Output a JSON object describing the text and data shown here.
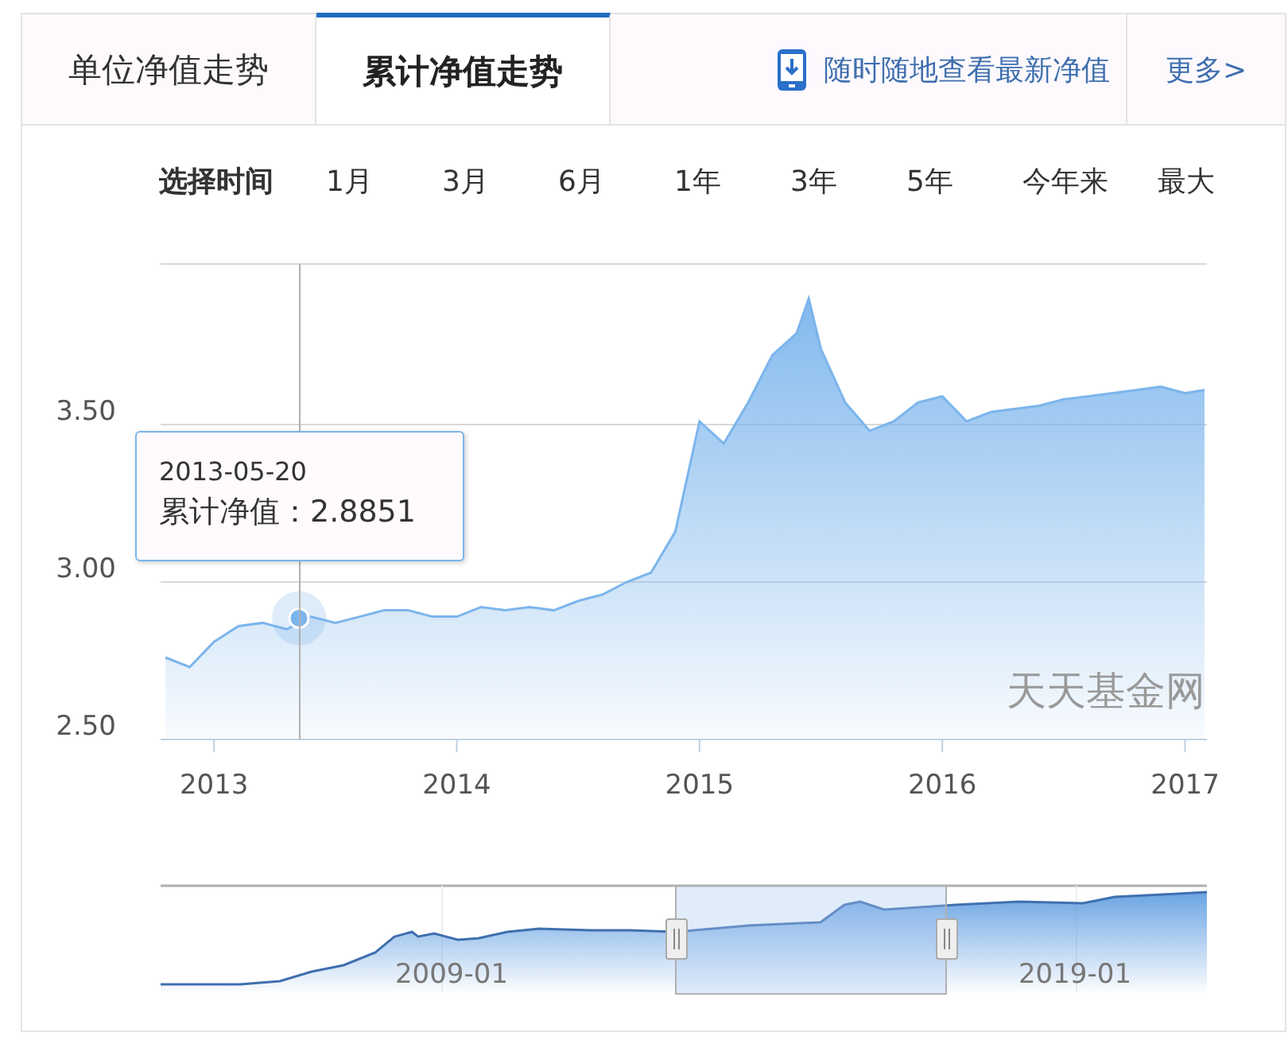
{
  "tabs": [
    {
      "label": "单位净值走势",
      "selected": false
    },
    {
      "label": "累计净值走势",
      "selected": true
    }
  ],
  "app_link": "随时随地查看最新净值",
  "more_link": "更多>",
  "range_label": "选择时间",
  "ranges": [
    {
      "label": "1月",
      "selected": false
    },
    {
      "label": "3月",
      "selected": false
    },
    {
      "label": "6月",
      "selected": false
    },
    {
      "label": "1年",
      "selected": false
    },
    {
      "label": "3年",
      "selected": false
    },
    {
      "label": "5年",
      "selected": false
    },
    {
      "label": "今年来",
      "selected": false
    },
    {
      "label": "最大",
      "selected": false
    }
  ],
  "chart": {
    "watermark": "天天基金网",
    "chart_data": {
      "type": "area",
      "x": [
        2012.8,
        2012.9,
        2013.0,
        2013.1,
        2013.2,
        2013.3,
        2013.4,
        2013.5,
        2013.6,
        2013.7,
        2013.8,
        2013.9,
        2014.0,
        2014.1,
        2014.2,
        2014.3,
        2014.4,
        2014.5,
        2014.6,
        2014.7,
        2014.8,
        2014.9,
        2015.0,
        2015.1,
        2015.2,
        2015.3,
        2015.4,
        2015.45,
        2015.5,
        2015.6,
        2015.7,
        2015.8,
        2015.9,
        2016.0,
        2016.1,
        2016.2,
        2016.3,
        2016.4,
        2016.5,
        2016.6,
        2016.7,
        2016.8,
        2016.9,
        2017.0,
        2017.08
      ],
      "series": [
        {
          "color": "#7cb5ec",
          "values": [
            2.76,
            2.73,
            2.81,
            2.86,
            2.87,
            2.85,
            2.89,
            2.87,
            2.89,
            2.91,
            2.91,
            2.89,
            2.89,
            2.92,
            2.91,
            2.92,
            2.91,
            2.94,
            2.96,
            3.0,
            3.03,
            3.16,
            3.51,
            3.44,
            3.57,
            3.72,
            3.79,
            3.9,
            3.74,
            3.57,
            3.48,
            3.51,
            3.57,
            3.59,
            3.51,
            3.54,
            3.55,
            3.56,
            3.58,
            3.59,
            3.6,
            3.61,
            3.62,
            3.6,
            3.61
          ]
        }
      ],
      "xlim": [
        2012.78,
        2017.09
      ],
      "ylim": [
        2.5,
        4.01
      ],
      "xticks": [
        2013,
        2014,
        2015,
        2016,
        2017
      ],
      "yticks": [
        {
          "value": 2.5,
          "label": "2.50"
        },
        {
          "value": 3.0,
          "label": "3.00"
        },
        {
          "value": 3.5,
          "label": "3.50"
        }
      ]
    },
    "tooltip": [
      "2013-05-20",
      "累计净值：2.8851"
    ]
  },
  "navigator": {
    "labels": [
      "2009-01",
      "2019-01"
    ]
  }
}
